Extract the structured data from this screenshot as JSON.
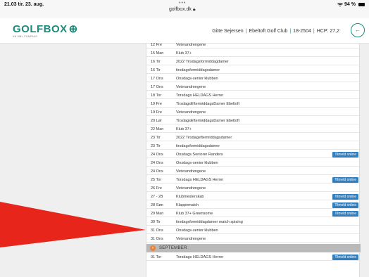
{
  "statusbar": {
    "time": "21.03",
    "date": "tir. 23. aug.",
    "dots": "•••",
    "url": "golfbox.dk",
    "wifi": "wifi-icon",
    "battery_text": "94 %"
  },
  "header": {
    "logo": "GOLFBOX",
    "logo_sub": "AN MBL COMPANY",
    "user_name": "Gitte Sejersen",
    "club": "Ebeltoft Golf Club",
    "member_id": "18-2504",
    "hcp": "HCP: 27,2",
    "back_icon": "arrow-left-icon"
  },
  "tilmeld_label": "Tilmeld online",
  "rows": [
    {
      "date": "12 Fre",
      "name": "Veterandrengene",
      "tilmeld": false
    },
    {
      "date": "15 Man",
      "name": "Klub 37+",
      "tilmeld": false
    },
    {
      "date": "16 Tir",
      "name": "2022 Tirsdagsformiddagdamer",
      "tilmeld": false
    },
    {
      "date": "16 Tir",
      "name": "tirsdagsformiddagsdamer",
      "tilmeld": false
    },
    {
      "date": "17 Ons",
      "name": "Onsdags-senior klubben",
      "tilmeld": false
    },
    {
      "date": "17 Ons",
      "name": "Veterandrengene",
      "tilmeld": false
    },
    {
      "date": "18 Tor",
      "name": "Torsdags HELDAGS Herrer",
      "tilmeld": false
    },
    {
      "date": "19 Fre",
      "name": "TirsdagsEftermiddagsDamer Ebeltoft",
      "tilmeld": false
    },
    {
      "date": "19 Fre",
      "name": "Veterandrengene",
      "tilmeld": false
    },
    {
      "date": "20 Lør",
      "name": "TirsdagsEftermiddagsDamer Ebeltoft",
      "tilmeld": false
    },
    {
      "date": "22 Man",
      "name": "Klub 37+",
      "tilmeld": false
    },
    {
      "date": "23 Tir",
      "name": "2022 Tirsdageftermiddagsdamer",
      "tilmeld": false
    },
    {
      "date": "23 Tir",
      "name": "tirsdagsformiddagsdamer",
      "tilmeld": false
    },
    {
      "date": "24 Ons",
      "name": "Onsdags Seniorer Randers",
      "tilmeld": true
    },
    {
      "date": "24 Ons",
      "name": "Onsdags-senior klubben",
      "tilmeld": false
    },
    {
      "date": "24 Ons",
      "name": "Veterandrengene",
      "tilmeld": false
    },
    {
      "date": "25 Tor",
      "name": "Torsdags HELDAGS Herrer",
      "tilmeld": true
    },
    {
      "date": "26 Fre",
      "name": "Veterandrengene",
      "tilmeld": false
    },
    {
      "date": "27 - 28",
      "name": "Klubmesterskab",
      "tilmeld": true
    },
    {
      "date": "28 Søn",
      "name": "Klappematch",
      "tilmeld": true
    },
    {
      "date": "29 Man",
      "name": "Klub 37+ Greensome",
      "tilmeld": true
    },
    {
      "date": "30 Tir",
      "name": "tirsdagsformiddagdamer match spiaing",
      "tilmeld": false
    },
    {
      "date": "31 Ons",
      "name": "Onsdags-senior klubben",
      "tilmeld": false
    },
    {
      "date": "31 Ons",
      "name": "Veterandrengene",
      "tilmeld": false
    }
  ],
  "section": {
    "label": "SEPTEMBER",
    "icon": "chevron-up-icon"
  },
  "next_row": {
    "date": "01 Tor",
    "name": "Torsdags HELDAGS Herrer",
    "tilmeld": true
  },
  "colors": {
    "brand": "#1a8c7d",
    "button": "#2f7fc1",
    "section_icon": "#e8833a",
    "annotation_arrow": "#e8251a"
  }
}
